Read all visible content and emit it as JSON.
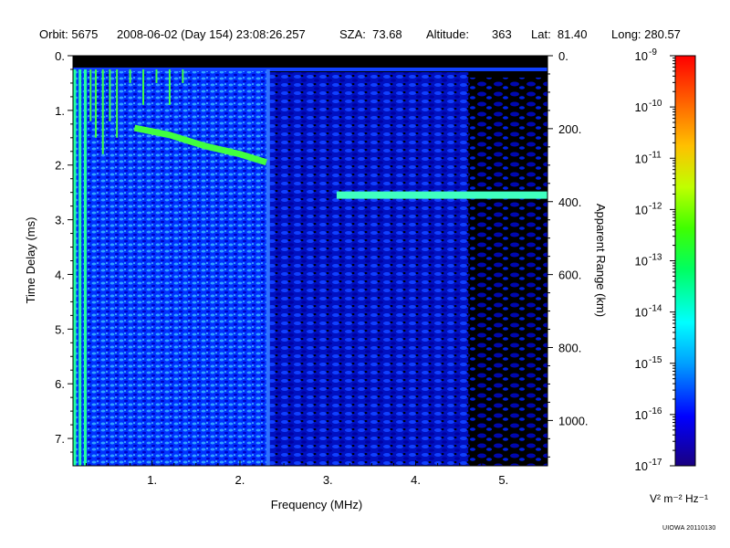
{
  "header": {
    "orbit": "Orbit: 5675",
    "datetime": "2008-06-02 (Day 154) 23:08:26.257",
    "sza": "SZA:  73.68",
    "altitude_label": "Altitude:",
    "altitude_value": "363",
    "lat": "Lat:  81.40",
    "long": "Long: 280.57"
  },
  "credit": "UIOWA 20110130",
  "colorbar_unit": "V² m⁻² Hz⁻¹",
  "colors": {
    "background": "#000000",
    "colormap": [
      "#1a0080",
      "#0000ff",
      "#00a0ff",
      "#00ffff",
      "#00ff60",
      "#40ff00",
      "#c0ff00",
      "#ffc000",
      "#ff6000",
      "#ff0000"
    ]
  },
  "chart_data": {
    "type": "heatmap",
    "xlabel": "Frequency (MHz)",
    "ylabel": "Time Delay (ms)",
    "y2label": "Apparent Range (km)",
    "xlim": [
      0.1,
      5.5
    ],
    "ylim": [
      0,
      7.5
    ],
    "y_inverted": true,
    "x_ticks": [
      1,
      2,
      3,
      4,
      5
    ],
    "x_tick_labels": [
      "1.",
      "2.",
      "3.",
      "4.",
      "5."
    ],
    "y_ticks": [
      0,
      1,
      2,
      3,
      4,
      5,
      6,
      7
    ],
    "y_tick_labels": [
      "0.",
      "1.",
      "2.",
      "3.",
      "4.",
      "5.",
      "6.",
      "7."
    ],
    "y2_ticks_km": [
      0,
      200,
      400,
      600,
      800,
      1000
    ],
    "y2_tick_labels": [
      "0.",
      "200.",
      "400.",
      "600.",
      "800.",
      "1000."
    ],
    "colorbar": {
      "scale": "log",
      "range": [
        1e-17,
        1e-09
      ],
      "tick_exponents": [
        -9,
        -10,
        -11,
        -12,
        -13,
        -14,
        -15,
        -16,
        -17
      ],
      "tick_base": "10"
    },
    "features": {
      "surface_echo": {
        "freq_range_mhz": [
          3.1,
          5.5
        ],
        "delay_ms": 2.55
      },
      "ionospheric_echo": [
        {
          "freq_mhz": 0.8,
          "delay_ms": 1.32
        },
        {
          "freq_mhz": 1.2,
          "delay_ms": 1.45
        },
        {
          "freq_mhz": 1.6,
          "delay_ms": 1.65
        },
        {
          "freq_mhz": 2.0,
          "delay_ms": 1.8
        },
        {
          "freq_mhz": 2.3,
          "delay_ms": 1.95
        }
      ],
      "plasma_cutoff_freq_mhz": 2.32,
      "transmit_pulse_delay_ms": 0.25
    }
  }
}
